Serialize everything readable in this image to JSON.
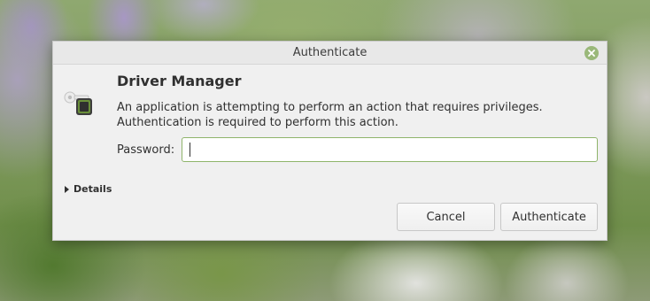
{
  "window": {
    "title": "Authenticate"
  },
  "dialog": {
    "app_name": "Driver Manager",
    "message": "An application is attempting to perform an action that requires privileges. Authentication is required to perform this action.",
    "password_label": "Password:",
    "password_value": "",
    "details_label": "Details",
    "cancel_label": "Cancel",
    "authenticate_label": "Authenticate"
  },
  "icons": {
    "close": "close-icon",
    "auth": "lock-key-icon",
    "details": "triangle-right-icon"
  },
  "colors": {
    "accent": "#8fb46b",
    "close_button": "#9ab87a",
    "dialog_bg": "#f0f0f0"
  }
}
